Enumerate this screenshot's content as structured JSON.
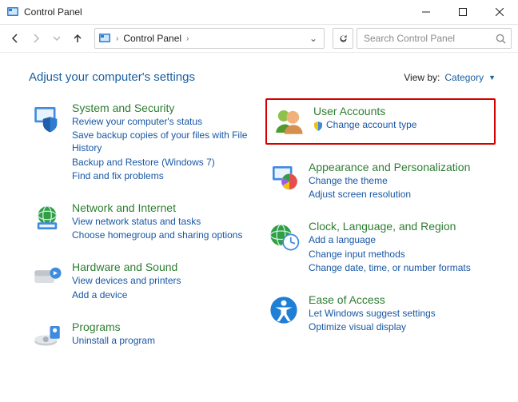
{
  "window": {
    "title": "Control Panel"
  },
  "breadcrumb": {
    "root": "Control Panel"
  },
  "search": {
    "placeholder": "Search Control Panel"
  },
  "heading": "Adjust your computer's settings",
  "viewby": {
    "label": "View by:",
    "value": "Category"
  },
  "left": [
    {
      "title": "System and Security",
      "links": [
        "Review your computer's status",
        "Save backup copies of your files with File History",
        "Backup and Restore (Windows 7)",
        "Find and fix problems"
      ]
    },
    {
      "title": "Network and Internet",
      "links": [
        "View network status and tasks",
        "Choose homegroup and sharing options"
      ]
    },
    {
      "title": "Hardware and Sound",
      "links": [
        "View devices and printers",
        "Add a device"
      ]
    },
    {
      "title": "Programs",
      "links": [
        "Uninstall a program"
      ]
    }
  ],
  "right": [
    {
      "title": "User Accounts",
      "shield": true,
      "links": [
        "Change account type"
      ]
    },
    {
      "title": "Appearance and Personalization",
      "links": [
        "Change the theme",
        "Adjust screen resolution"
      ]
    },
    {
      "title": "Clock, Language, and Region",
      "links": [
        "Add a language",
        "Change input methods",
        "Change date, time, or number formats"
      ]
    },
    {
      "title": "Ease of Access",
      "links": [
        "Let Windows suggest settings",
        "Optimize visual display"
      ]
    }
  ]
}
